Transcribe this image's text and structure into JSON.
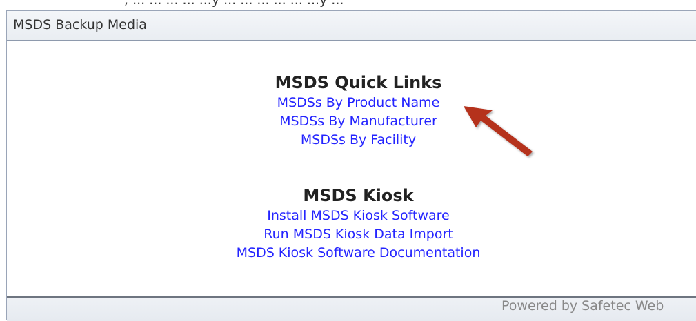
{
  "top_strip_text": ", ... ... ... ... ...y ... ... ... ... ... ...y ...",
  "panel": {
    "title": "MSDS Backup Media"
  },
  "quick_links": {
    "heading": "MSDS Quick Links",
    "links": [
      "MSDSs By Product Name",
      "MSDSs By Manufacturer",
      "MSDSs By Facility"
    ]
  },
  "kiosk": {
    "heading": "MSDS Kiosk",
    "links": [
      "Install MSDS Kiosk Software",
      "Run MSDS Kiosk Data Import",
      "MSDS Kiosk Software Documentation"
    ]
  },
  "footer": {
    "text": "Powered by Safetec Web"
  },
  "annotation": {
    "arrow_color": "#b5301e"
  },
  "colors": {
    "link": "#2424ff",
    "header_bg": "#eceff3",
    "border": "#9aa5b8"
  }
}
